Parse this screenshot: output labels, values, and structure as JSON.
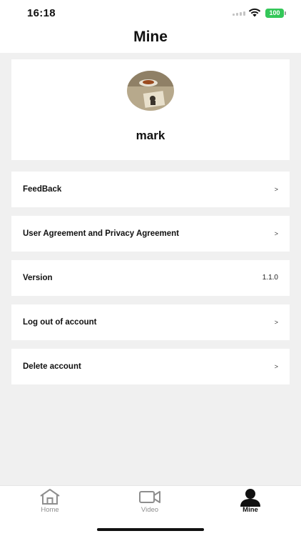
{
  "status_bar": {
    "time": "16:18",
    "battery": "100"
  },
  "header": {
    "title": "Mine"
  },
  "profile": {
    "username": "mark"
  },
  "menu": {
    "items": [
      {
        "label": "FeedBack",
        "chevron": ">"
      },
      {
        "label": "User Agreement and Privacy Agreement",
        "chevron": ">"
      },
      {
        "label": "Version",
        "value": "1.1.0"
      },
      {
        "label": "Log out of account",
        "chevron": ">"
      },
      {
        "label": "Delete account",
        "chevron": ">"
      }
    ]
  },
  "tabbar": {
    "tabs": [
      {
        "label": "Home",
        "icon": "home-icon",
        "active": false
      },
      {
        "label": "Video",
        "icon": "video-camera-icon",
        "active": false
      },
      {
        "label": "Mine",
        "icon": "person-icon",
        "active": true
      }
    ]
  },
  "colors": {
    "active_tab": "#111111",
    "inactive_tab": "#8e8e8e",
    "battery": "#34c759",
    "background": "#f0f0f0"
  }
}
